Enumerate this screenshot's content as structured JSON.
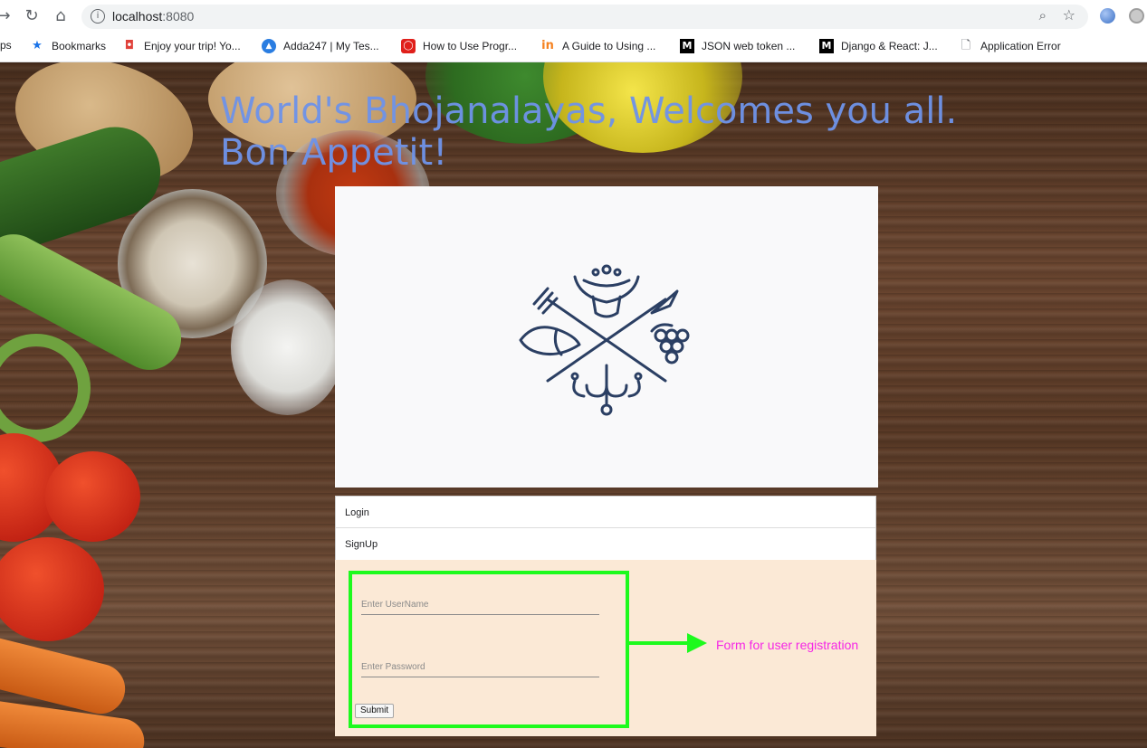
{
  "browser": {
    "url_host": "localhost",
    "url_port": ":8080",
    "bookmarks": [
      {
        "label": "ps",
        "icon": "apps-icon"
      },
      {
        "label": "Bookmarks",
        "icon": "star-icon"
      },
      {
        "label": "Enjoy your trip! Yo...",
        "icon": "trip-icon"
      },
      {
        "label": "Adda247 | My Tes...",
        "icon": "adda-icon"
      },
      {
        "label": "How to Use Progr...",
        "icon": "oracle-icon"
      },
      {
        "label": "A Guide to Using ...",
        "icon": "in-icon"
      },
      {
        "label": "JSON web token ...",
        "icon": "medium-icon"
      },
      {
        "label": "Django & React: J...",
        "icon": "medium-icon"
      },
      {
        "label": "Application Error",
        "icon": "page-icon"
      }
    ]
  },
  "page": {
    "headline": "World's Bhojanalayas, Welcomes you all. Bon Appetit!",
    "menu": {
      "login": "Login",
      "signup": "SignUp"
    },
    "form": {
      "username_placeholder": "Enter UserName",
      "password_placeholder": "Enter Password",
      "submit_label": "Submit"
    },
    "annotation": "Form for user registration"
  },
  "colors": {
    "headline": "#6f93e8",
    "highlight_box": "#1dfa1d",
    "annotation": "#f527e5",
    "form_panel": "#fbe9d6",
    "logo_stroke": "#2b3f63"
  }
}
